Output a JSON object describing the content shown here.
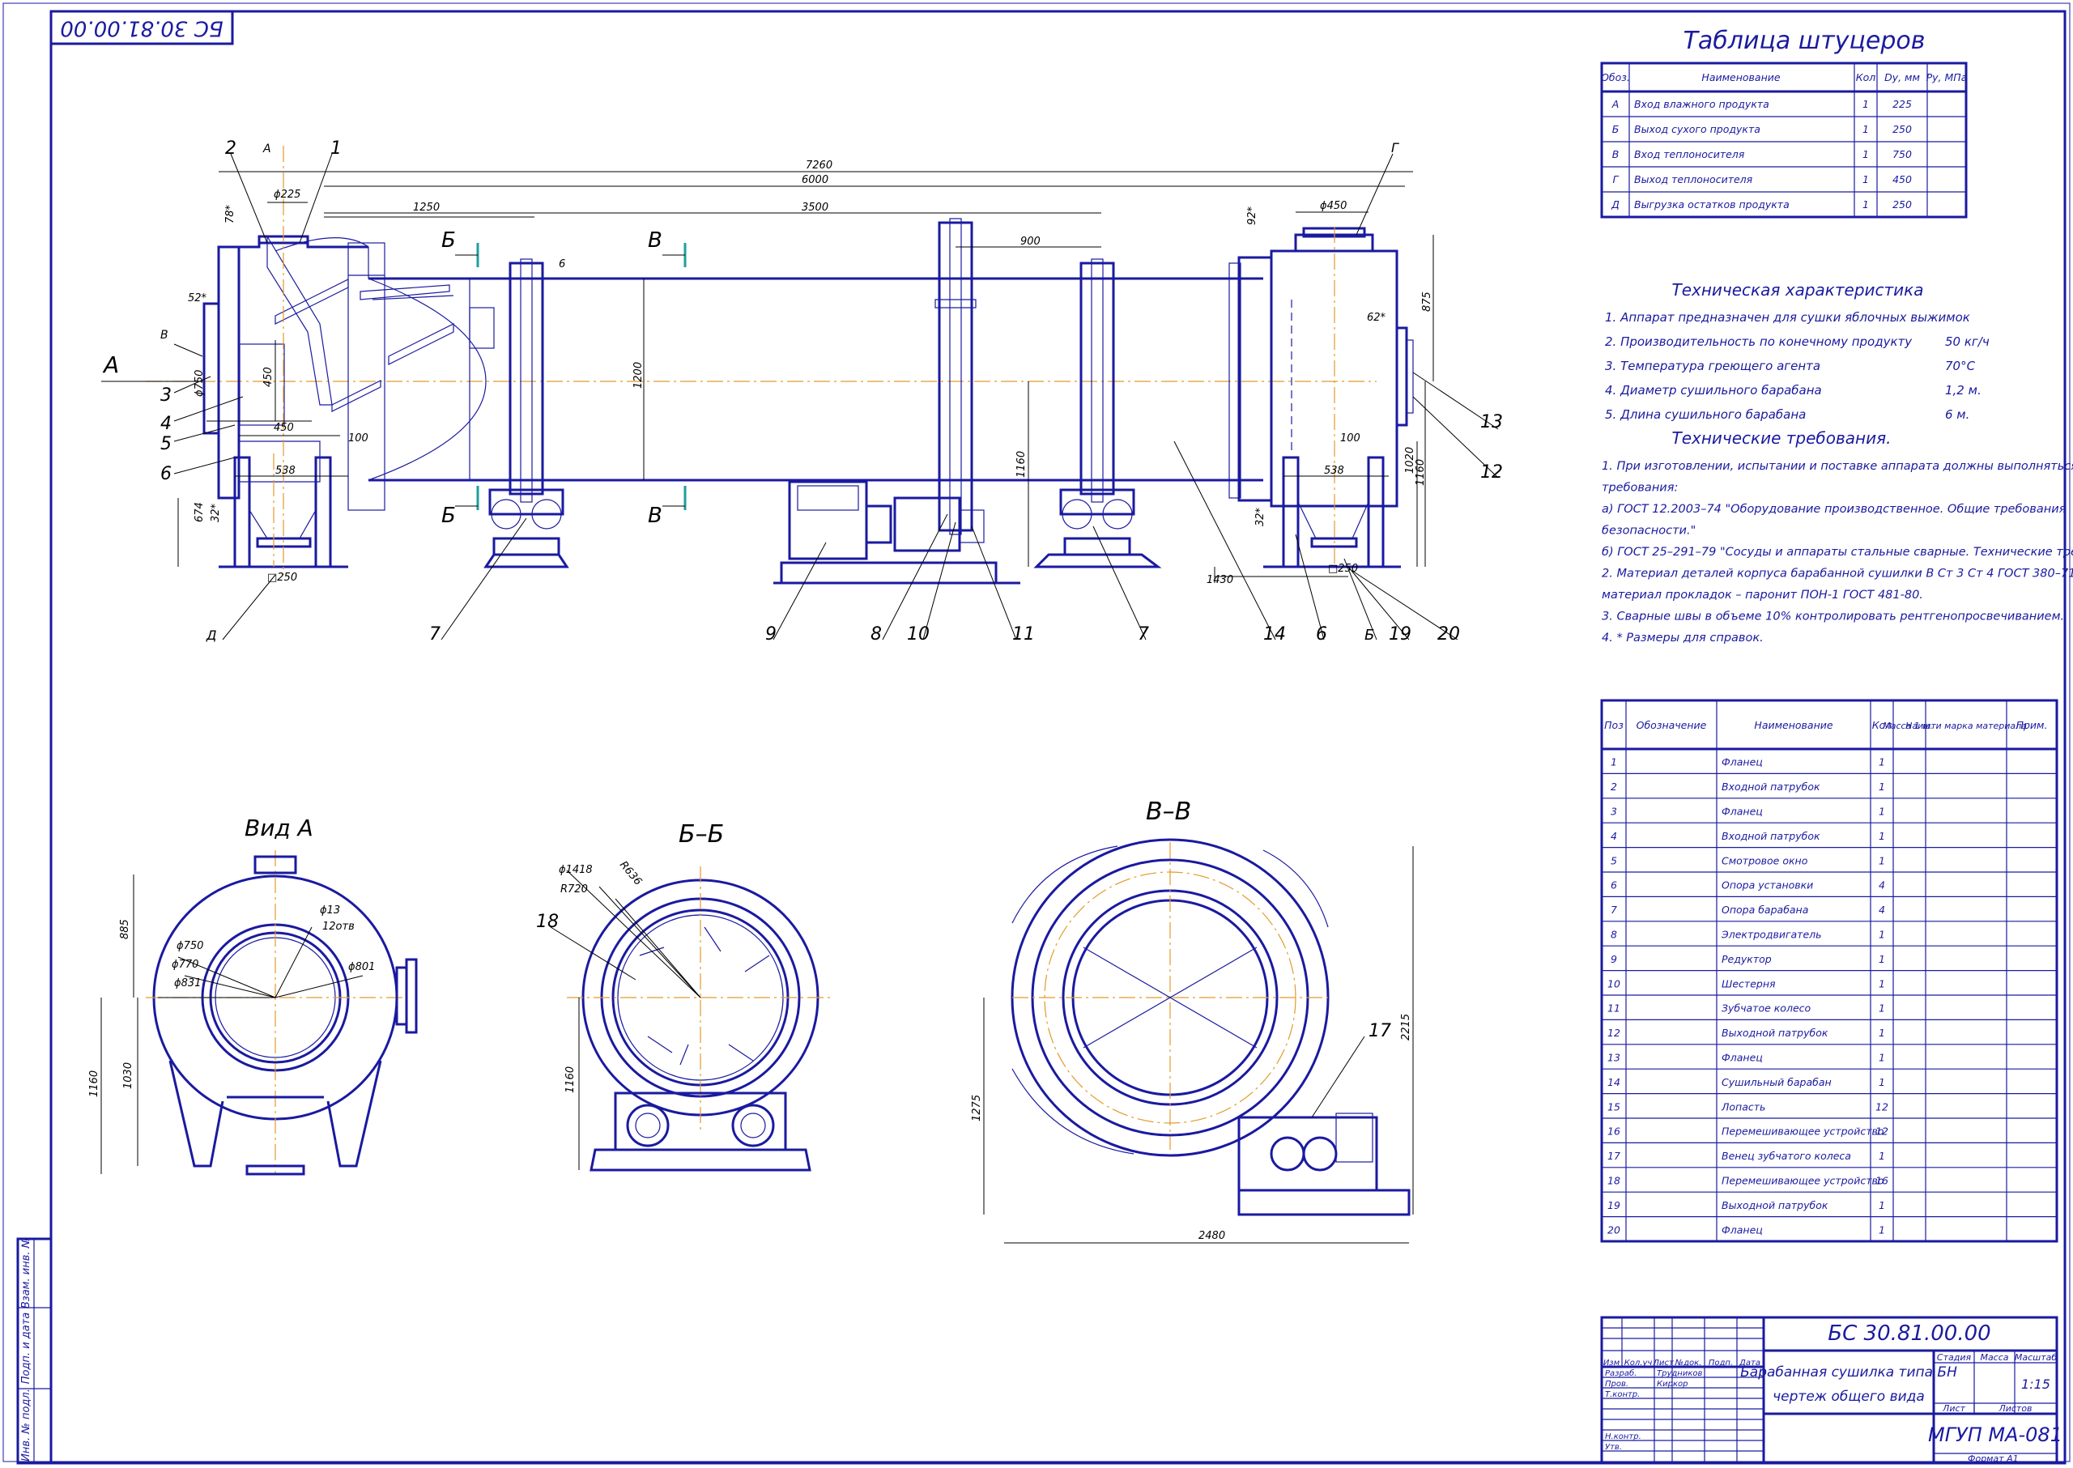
{
  "stamp_top": "БС 30.81.00.00",
  "views": {
    "front_label_A": "А",
    "section_b_left": "Б",
    "section_v_left": "В",
    "vid_a": "Вид А",
    "b_b": "Б–Б",
    "v_v": "В–В"
  },
  "dims": {
    "d7260": "7260",
    "d6000": "6000",
    "d3500": "3500",
    "d1250": "1250",
    "d900": "900",
    "d225": "ϕ225",
    "d450t": "ϕ450",
    "a78": "78*",
    "a52": "52*",
    "a92": "92*",
    "a62": "62*",
    "d750": "ϕ750",
    "d450": "450",
    "d450b": "450",
    "d100": "100",
    "d538": "538",
    "d674": "674",
    "a32": "32*",
    "d1250s": "□250",
    "d1200": "1200",
    "d1160": "1160",
    "d875": "875",
    "d100r": "100",
    "d538r": "538",
    "d1020": "1020",
    "d1160r": "1160",
    "d1430": "1430",
    "d250r": "□250",
    "a32r": "32*",
    "d6": "6",
    "va_885": "885",
    "va_1160": "1160",
    "va_1030": "1030",
    "va_13": "ϕ13",
    "va_12": "12отв",
    "va_750": "ϕ750",
    "va_770": "ϕ770",
    "va_831": "ϕ831",
    "va_801": "ϕ801",
    "bb_1418": "ϕ1418",
    "bb_r636": "R636",
    "bb_r720": "R720",
    "bb_1160": "1160",
    "vv_1275": "1275",
    "vv_2215": "2215",
    "vv_2480": "2480"
  },
  "callouts": [
    "1",
    "2",
    "3",
    "4",
    "5",
    "6",
    "7",
    "7",
    "8",
    "9",
    "10",
    "11",
    "12",
    "13",
    "14",
    "6",
    "Б",
    "19",
    "20",
    "Г",
    "Д",
    "А",
    "В",
    "18",
    "17"
  ],
  "nozzle_table": {
    "title": "Таблица штуцеров",
    "headers": [
      "Обоз.",
      "Наименование",
      "Кол",
      "Dу, мм",
      "Ру, МПа"
    ],
    "rows": [
      [
        "А",
        "Вход влажного продукта",
        "1",
        "225",
        ""
      ],
      [
        "Б",
        "Выход сухого продукта",
        "1",
        "250",
        ""
      ],
      [
        "В",
        "Вход теплоносителя",
        "1",
        "750",
        ""
      ],
      [
        "Г",
        "Выход теплоносителя",
        "1",
        "450",
        ""
      ],
      [
        "Д",
        "Выгрузка остатков продукта",
        "1",
        "250",
        ""
      ]
    ]
  },
  "tech_char": {
    "title": "Техническая характеристика",
    "items": [
      {
        "n": "1",
        "text": "Аппарат предназначен для сушки яблочных выжимок",
        "val": ""
      },
      {
        "n": "2",
        "text": "Производительность по конечному продукту",
        "val": "50 кг/ч"
      },
      {
        "n": "3",
        "text": "Температура греющего агента",
        "val": "70°C"
      },
      {
        "n": "4",
        "text": "Диаметр сушильного барабана",
        "val": "1,2 м."
      },
      {
        "n": "5",
        "text": "Длина сушильного барабана",
        "val": "6 м."
      }
    ]
  },
  "tech_req": {
    "title": "Технические требования.",
    "lines": [
      "1. При   изготовлении, испытании и поставке аппарата должны выполняться",
      "требования:",
      "  а) ГОСТ 12.2003–74   \"Оборудование производственное. Общие требования",
      "безопасности.\"",
      "  б) ГОСТ 25–291–79 \"Сосуды и аппараты стальные сварные. Технические требования.\"",
      "2. Материал деталей корпуса барабанной сушилки В   Ст 3     Ст 4 ГОСТ 380–71,",
      "материал прокладок – паронит ПОН-1 ГОСТ 481-80.",
      "3. Сварные швы в объеме 10% контролировать рентгенопросвечиванием.",
      "4. * Размеры для справок."
    ]
  },
  "spec_table": {
    "headers": [
      "Поз",
      "Обозначение",
      "Наименование",
      "Кол",
      "Масса 1 шт",
      "Наим. и марка материала",
      "Прим."
    ],
    "rows": [
      [
        "1",
        "",
        "Фланец",
        "1"
      ],
      [
        "2",
        "",
        "Входной патрубок",
        "1"
      ],
      [
        "3",
        "",
        "Фланец",
        "1"
      ],
      [
        "4",
        "",
        "Входной патрубок",
        "1"
      ],
      [
        "5",
        "",
        "Смотровое окно",
        "1"
      ],
      [
        "6",
        "",
        "Опора установки",
        "4"
      ],
      [
        "7",
        "",
        "Опора барабана",
        "4"
      ],
      [
        "8",
        "",
        "Электродвигатель",
        "1"
      ],
      [
        "9",
        "",
        "Редуктор",
        "1"
      ],
      [
        "10",
        "",
        "Шестерня",
        "1"
      ],
      [
        "11",
        "",
        "Зубчатое колесо",
        "1"
      ],
      [
        "12",
        "",
        "Выходной патрубок",
        "1"
      ],
      [
        "13",
        "",
        "Фланец",
        "1"
      ],
      [
        "14",
        "",
        "Сушильный барабан",
        "1"
      ],
      [
        "15",
        "",
        "Лопасть",
        "12"
      ],
      [
        "16",
        "",
        "Перемешивающее устройство",
        "12"
      ],
      [
        "17",
        "",
        "Венец зубчатого колеса",
        "1"
      ],
      [
        "18",
        "",
        "Перемешивающее устройство",
        "16"
      ],
      [
        "19",
        "",
        "Выходной патрубок",
        "1"
      ],
      [
        "20",
        "",
        "Фланец",
        "1"
      ]
    ]
  },
  "title_block": {
    "code": "БС 30.81.00.00",
    "name_line1": "Барабанная сушилка типа БН",
    "name_line2": "чертеж общего вида",
    "org": "МГУП МА-081",
    "scale": "1:15",
    "stage_h": "Стадия",
    "mass_h": "Масса",
    "scale_h": "Масштаб",
    "sheet_h": "Лист",
    "sheets_h": "Листов",
    "col_izm": "Изм",
    "col_koluch": "Кол.уч",
    "col_list": "Лист",
    "col_ndok": "№док.",
    "col_podp": "Подп.",
    "col_data": "Дата",
    "razrab": "Разраб.",
    "prov": "Пров.",
    "tkontr": "Т.контр.",
    "nkontr": "Н.контр.",
    "utv": "Утв.",
    "razrab_name": "Трудников",
    "prov_name": "Киркор",
    "format": "Формат    А1"
  },
  "side_strip": [
    "Инв. № подл.",
    "Подп. и дата",
    "Взам. инв. №"
  ]
}
